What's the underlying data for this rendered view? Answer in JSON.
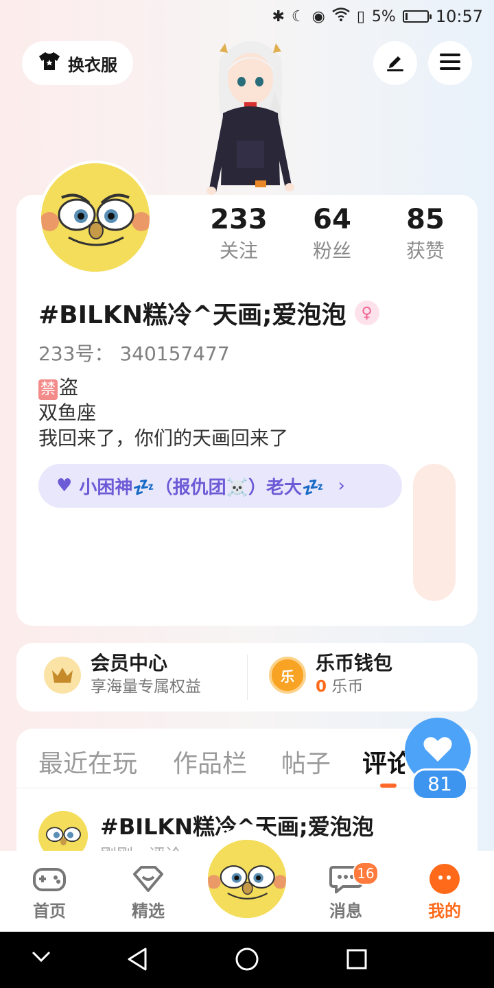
{
  "status_bar": {
    "battery": "5%",
    "time": "10:57"
  },
  "top_bar": {
    "outfit_label": "换衣服"
  },
  "profile": {
    "stats": [
      {
        "value": "233",
        "label": "关注"
      },
      {
        "value": "64",
        "label": "粉丝"
      },
      {
        "value": "85",
        "label": "获赞"
      }
    ],
    "username": "#BILKN糕冷^天画;爱泡泡",
    "id_text": "233号： 340157477",
    "bio_tag": "禁",
    "bio_line1": "盗",
    "bio_line2": "双鱼座",
    "bio_line3": "我回来了，你们的天画回来了",
    "guild": "小困神💤（报仇团☠️）老大💤"
  },
  "quick_links": {
    "member_title": "会员中心",
    "member_sub": "享海量专属权益",
    "wallet_title": "乐币钱包",
    "wallet_amount": "0",
    "wallet_unit": "乐币",
    "wallet_icon_char": "乐"
  },
  "tabs": [
    "最近在玩",
    "作品栏",
    "帖子",
    "评论"
  ],
  "feed": {
    "name": "#BILKN糕冷^天画;爱泡泡",
    "meta": "刚刚 · 评论"
  },
  "like": {
    "count": "81"
  },
  "bottom_nav": {
    "items": [
      "首页",
      "精选",
      "消息",
      "我的"
    ],
    "message_badge": "16"
  },
  "colors": {
    "accent": "#ff6a1a",
    "like_blue": "#4da3f7",
    "guild_text": "#6b5bd6"
  }
}
